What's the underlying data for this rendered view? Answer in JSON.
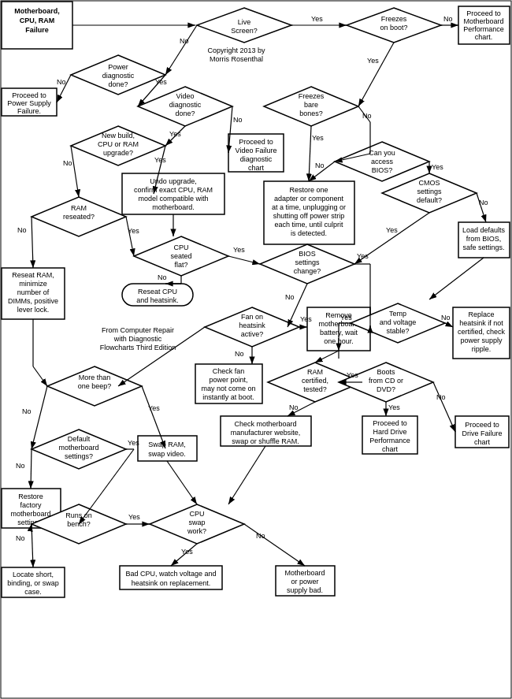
{
  "title": "Motherboard, CPU, RAM Failure Flowchart",
  "copyright": "Copyright 2013 by Morris Rosenthal",
  "source": "From Computer Repair with Diagnostic Flowcharts Third Edition",
  "nodes": {
    "title": "Motherboard,\nCPU, RAM\nFailure",
    "live_screen": "Live\nScreen?",
    "power_diag": "Power\ndiagnostic\ndone?",
    "video_diag": "Video\ndiagnostic\ndone?",
    "freezes_boot": "Freezes\non boot?",
    "freezes_bare": "Freezes\nbare\nbones?",
    "new_build": "New build,\nCPU or RAM\nupgrade?",
    "ram_reseated": "RAM\nreseated?",
    "cpu_seated": "CPU\nseated\nflat?",
    "bios_change": "BIOS\nsettings\nchange?",
    "fan_heatsink": "Fan on\nheatsink\nactive?",
    "more_beep": "More than\none beep?",
    "default_mb": "Default\nmotherboard\nsettings?",
    "runs_bench": "Runs on\nbench?",
    "cpu_swap": "CPU\nswap\nwork?",
    "can_bios": "Can you\naccess\nBIOS?",
    "cmos_default": "CMOS\nsettings\ndefault?",
    "temp_voltage": "Temp\nand voltage\nstable?",
    "ram_certified": "RAM\ncertified,\ntested?",
    "boots_cd": "Boots\nfrom CD or\nDVD?",
    "proceed_power": "Proceed to\nPower Supply\nFailure.",
    "proceed_video": "Proceed to\nVideo Failure\ndiagnostic\nchart",
    "proceed_mb_perf": "Proceed to\nMotherboard\nPerformance\nchart.",
    "undo_upgrade": "Undo upgrade,\nconfirm  exact CPU, RAM\nmodel compatible with\nmotherboard.",
    "reseat_cpu": "Reseat CPU\nand heatsink.",
    "reseat_ram": "Reseat RAM,\nminimize\nnumber of\nDIMMs, positive\nlever lock.",
    "restore_one": "Restore one\nadapter or component\nat a time, unplugging or\nshutting off power strip\neach time, until culprit\nis detected.",
    "check_fan": "Check fan\npower point,\nmay not come on\ninstantly at boot.",
    "remove_battery": "Remove\nmotherboard\nbattery, wait\none hour.",
    "swap_ram_video": "Swap RAM,\nswap video.",
    "restore_factory": "Restore\nfactory\nmotherboard\nsettings.",
    "locate_short": "Locate short,\nbinding, or swap\ncase.",
    "bad_cpu": "Bad CPU, watch voltage and\nheatsink on replacement.",
    "motherboard_bad": "Motherboard\nor power\nsupply bad.",
    "load_defaults": "Load defaults\nfrom BIOS,\nsafe settings.",
    "replace_heatsink": "Replace\nheatsink if not\ncertified, check\npower supply\nripple.",
    "check_mb_website": "Check motherboard\nmanufacturer website,\nswap or shuffle RAM.",
    "hard_drive_chart": "Proceed to\nHard Drive\nPerformance\nchart",
    "drive_failure": "Proceed to\nDrive Failure\nchart"
  }
}
